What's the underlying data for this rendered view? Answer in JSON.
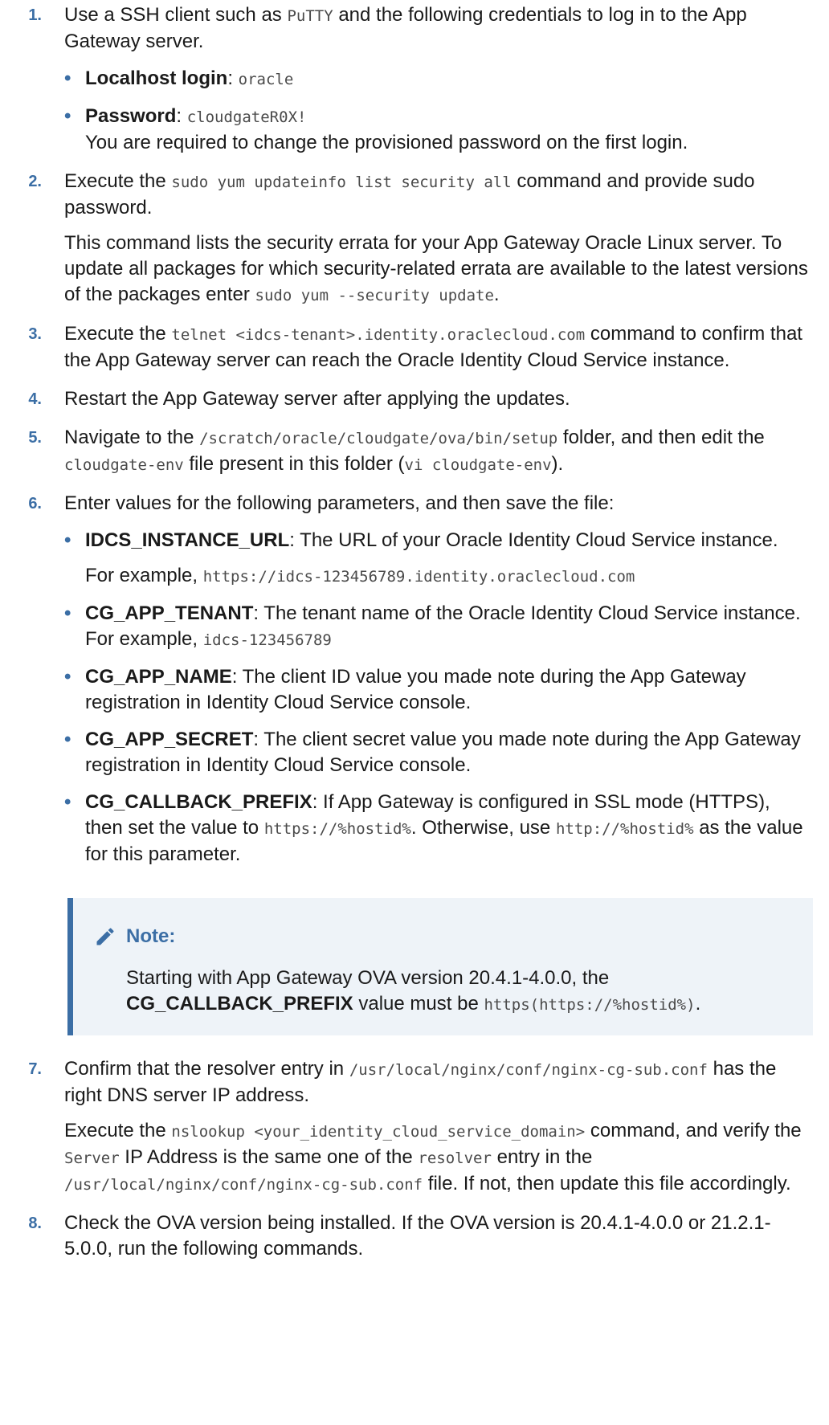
{
  "steps": [
    {
      "n": "1.",
      "text_a": "Use a SSH client such as ",
      "code_a": "PuTTY",
      "text_b": " and the following credentials to log in to the App Gateway server.",
      "bullets": [
        {
          "label": "Localhost login",
          "sep": ": ",
          "code": "oracle"
        },
        {
          "label": "Password",
          "sep": ": ",
          "code": "cloudgateR0X!",
          "extra": "You are required to change the provisioned password on the first login."
        }
      ]
    },
    {
      "n": "2.",
      "text_a": "Execute the ",
      "code_a": "sudo yum updateinfo list security all",
      "text_b": " command and provide sudo password.",
      "para_a": "This command lists the security errata for your App Gateway Oracle Linux server. To update all packages for which security-related errata are available to the latest versions of the packages enter ",
      "para_code": "sudo yum --security update",
      "para_b": "."
    },
    {
      "n": "3.",
      "text_a": "Execute the ",
      "code_a": "telnet <idcs-tenant>.identity.oraclecloud.com",
      "text_b": " command to confirm that the App Gateway server can reach the Oracle Identity Cloud Service instance."
    },
    {
      "n": "4.",
      "text": "Restart the App Gateway server after applying the updates."
    },
    {
      "n": "5.",
      "text_a": "Navigate to the ",
      "code_a": "/scratch/oracle/cloudgate/ova/bin/setup",
      "text_b": " folder, and then edit the ",
      "code_b": "cloudgate-env",
      "text_c": " file present in this folder (",
      "code_c": "vi cloudgate-env",
      "text_d": ")."
    },
    {
      "n": "6.",
      "text": "Enter values for the following parameters, and then save the file:",
      "b1": {
        "label": "IDCS_INSTANCE_URL",
        "text": ": The URL of your Oracle Identity Cloud Service instance.",
        "ex": "For example, ",
        "ex_code": "https://idcs-123456789.identity.oraclecloud.com"
      },
      "b2": {
        "label": "CG_APP_TENANT",
        "text": ": The tenant name of the Oracle Identity Cloud Service instance.",
        "ex": "For example, ",
        "ex_code": "idcs-123456789"
      },
      "b3": {
        "label": "CG_APP_NAME",
        "text": ": The client ID value you made note during the App Gateway registration in Identity Cloud Service console."
      },
      "b4": {
        "label": "CG_APP_SECRET",
        "text": ": The client secret value you made note during the App Gateway registration in Identity Cloud Service console."
      },
      "b5": {
        "label": "CG_CALLBACK_PREFIX",
        "text_a": ": If App Gateway is configured in SSL mode (HTTPS), then set the value to ",
        "code_a": "https://%hostid%",
        "text_b": ". Otherwise, use ",
        "code_b": "http://%hostid%",
        "text_c": " as the value for this parameter."
      },
      "note": {
        "title": "Note:",
        "icon": "pencil-icon",
        "text_a": "Starting with App Gateway OVA version 20.4.1-4.0.0, the ",
        "bold": "CG_CALLBACK_PREFIX",
        "text_b": " value must be ",
        "code": "https(https://%hostid%)",
        "text_c": "."
      }
    },
    {
      "n": "7.",
      "text_a": "Confirm that the resolver entry in ",
      "code_a": "/usr/local/nginx/conf/nginx-cg-sub.conf",
      "text_b": " has the right DNS server IP address.",
      "p_a": "Execute the ",
      "p_code_a": "nslookup <your_identity_cloud_service_domain>",
      "p_b": " command, and verify the ",
      "p_code_b": "Server",
      "p_c": " IP Address is the same one of the ",
      "p_code_c": "resolver",
      "p_d": " entry in the ",
      "p_code_d": "/usr/local/nginx/conf/nginx-cg-sub.conf",
      "p_e": " file. If not, then update this file accordingly."
    },
    {
      "n": "8.",
      "text": "Check the OVA version being installed. If the OVA version is 20.4.1-4.0.0 or 21.2.1-5.0.0, run the following commands."
    }
  ],
  "colors": {
    "accent": "#3b6ea5",
    "note_bg": "#eef3f8",
    "text": "#1a1a1a",
    "code": "#4a4a4a"
  }
}
